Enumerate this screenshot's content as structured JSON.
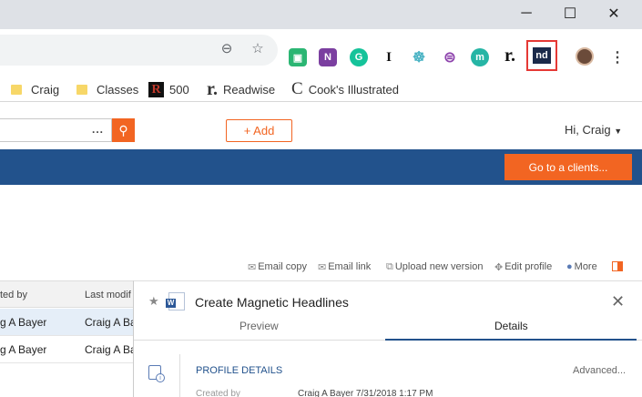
{
  "window": {
    "minimize": "─",
    "maximize": "☐",
    "close": "✕"
  },
  "toolbar": {
    "zoom_icon": "zoom-out-icon",
    "star_icon": "star-icon",
    "extensions": [
      {
        "name": "ext-green",
        "label": "▣",
        "color": "#2bb673"
      },
      {
        "name": "ext-onenote",
        "label": "N",
        "color": "#7b3fa0"
      },
      {
        "name": "ext-grammarly",
        "label": "G",
        "color": "#15c39a"
      },
      {
        "name": "ext-instapaper",
        "label": "I",
        "color": "#ffffff"
      },
      {
        "name": "ext-octopus",
        "label": "☸",
        "color": "#4ab3c4"
      },
      {
        "name": "ext-purple",
        "label": "⊜",
        "color": "#8e44ad"
      },
      {
        "name": "ext-m",
        "label": "m",
        "color": "#26b5a5"
      },
      {
        "name": "ext-readwise",
        "label": "r.",
        "color": "#ffffff"
      },
      {
        "name": "ext-nd",
        "label": "nd",
        "color": "#1b2a4a"
      }
    ],
    "menu_icon": "⋮"
  },
  "bookmarks": [
    {
      "label": "Craig",
      "type": "folder"
    },
    {
      "label": "Classes",
      "type": "folder"
    },
    {
      "label": "500",
      "type": "r500"
    },
    {
      "label": "Readwise",
      "type": "readwise"
    },
    {
      "label": "Cook's Illustrated",
      "type": "cooks"
    }
  ],
  "header": {
    "search_dots": "...",
    "add_label": "+ Add",
    "greeting": "Hi,  Craig"
  },
  "banner": {
    "goto_label": "Go to a clients..."
  },
  "actions": [
    {
      "name": "email-copy",
      "icon": "✉",
      "label": "Email copy"
    },
    {
      "name": "email-link",
      "icon": "✉",
      "label": "Email link"
    },
    {
      "name": "upload-version",
      "icon": "⧉",
      "label": "Upload new version"
    },
    {
      "name": "edit-profile",
      "icon": "✥",
      "label": "Edit profile"
    },
    {
      "name": "more",
      "icon": "●",
      "label": "More"
    }
  ],
  "list": {
    "columns": [
      "ted by",
      "Last modif"
    ],
    "rows": [
      {
        "created": "g A Bayer",
        "modified": "Craig A Ba",
        "selected": true
      },
      {
        "created": "g A Bayer",
        "modified": "Craig A Ba",
        "selected": false
      }
    ]
  },
  "preview": {
    "title": "Create Magnetic Headlines",
    "tabs": [
      "Preview",
      "Details"
    ],
    "active_tab": "Details",
    "section": "PROFILE DETAILS",
    "advanced": "Advanced...",
    "created_label": "Created by",
    "created_value": "Craig A Bayer 7/31/2018 1:17 PM"
  },
  "colors": {
    "accent": "#f26522",
    "brand": "#22528c",
    "highlight": "#e53935"
  }
}
